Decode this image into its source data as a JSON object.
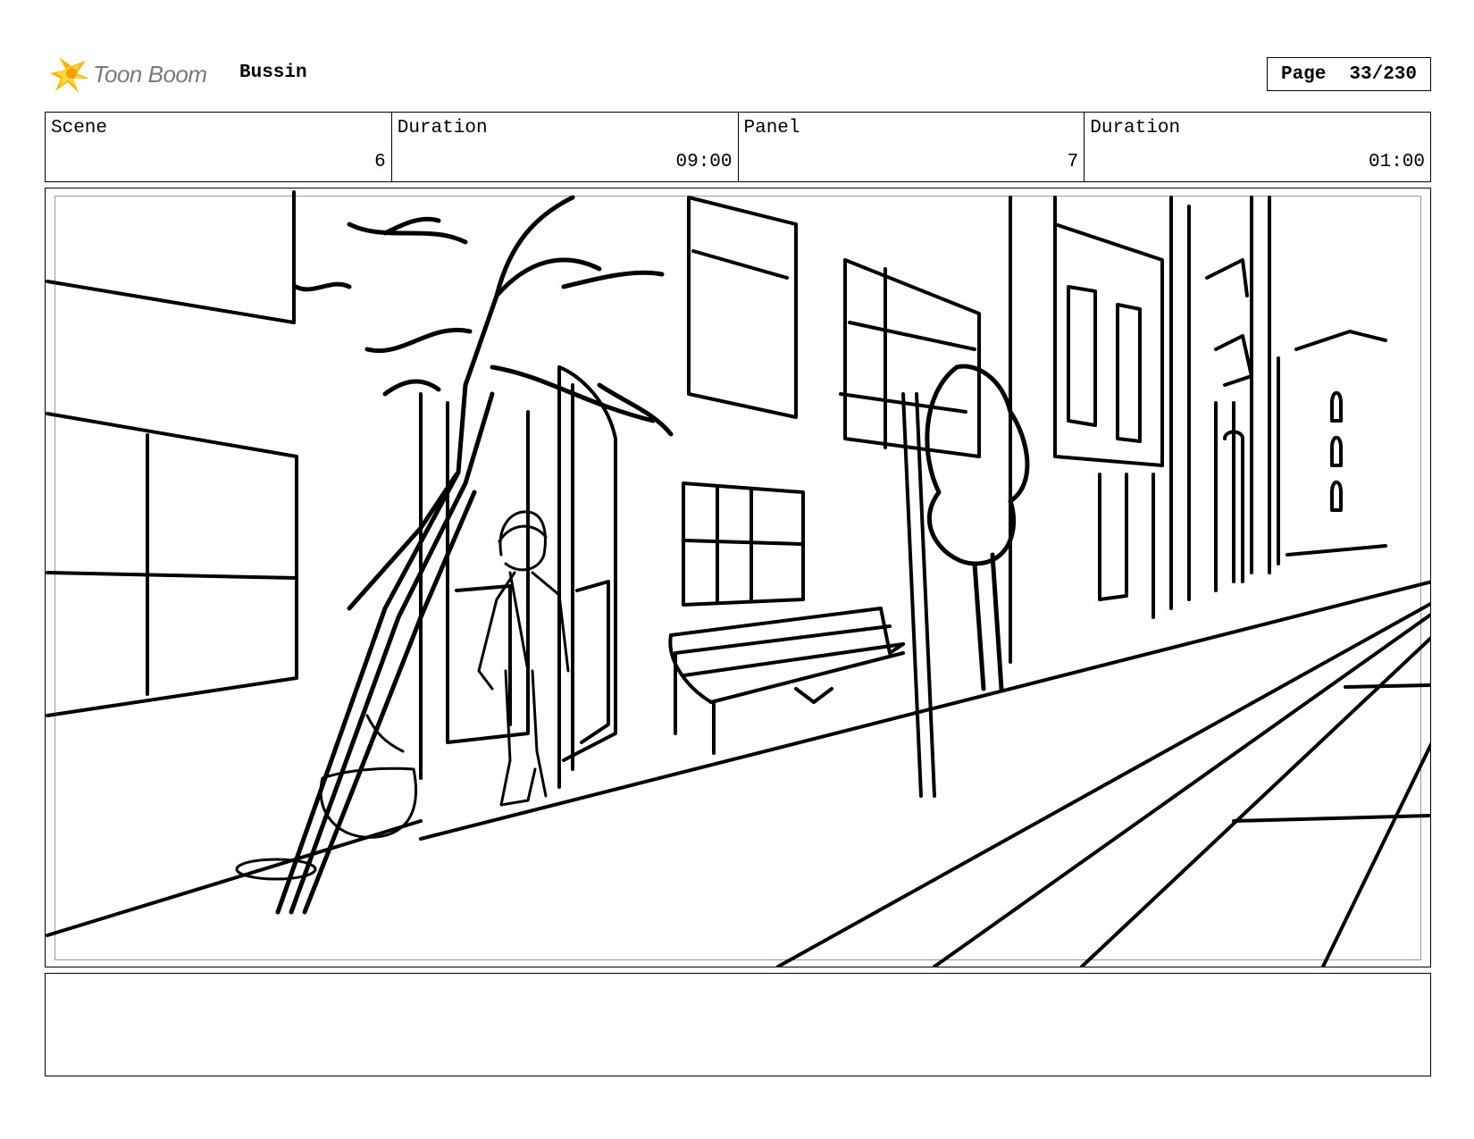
{
  "header": {
    "brand": "Toon Boom",
    "project": "Bussin",
    "page_label": "Page",
    "page_value": "33/230"
  },
  "info": {
    "scene_label": "Scene",
    "scene_value": "6",
    "scene_duration_label": "Duration",
    "scene_duration_value": "09:00",
    "panel_label": "Panel",
    "panel_value": "7",
    "panel_duration_label": "Duration",
    "panel_duration_value": "01:00"
  },
  "notes": {
    "text": ""
  },
  "colors": {
    "logo_accent": "#f5b800",
    "logo_text": "#7a7a7a"
  },
  "icons": {
    "logo": "toon-boom-star-icon"
  }
}
